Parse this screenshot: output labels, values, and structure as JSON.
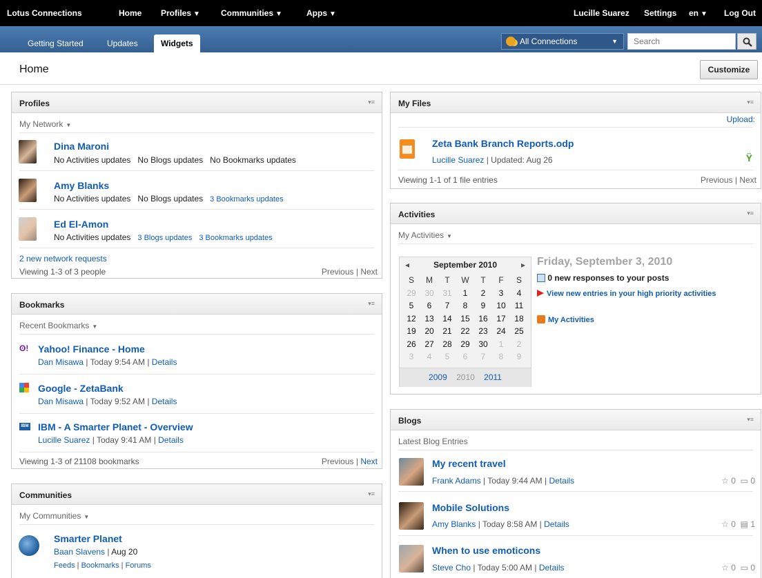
{
  "topbar": {
    "brand": "Lotus Connections",
    "nav": [
      "Home",
      "Profiles",
      "Communities",
      "Apps"
    ],
    "user": "Lucille Suarez",
    "settings": "Settings",
    "lang": "en",
    "logout": "Log Out"
  },
  "tabs": [
    "Getting Started",
    "Updates",
    "Widgets"
  ],
  "active_tab": "Widgets",
  "search": {
    "scope": "All Connections",
    "placeholder": "Search"
  },
  "page": {
    "title": "Home",
    "customize": "Customize"
  },
  "profiles": {
    "title": "Profiles",
    "filter": "My Network",
    "people": [
      {
        "name": "Dina Maroni",
        "updates": [
          "No Activities updates",
          "No Blogs updates",
          "No Bookmarks updates"
        ]
      },
      {
        "name": "Amy Blanks",
        "updates": [
          "No Activities updates",
          "No Blogs updates",
          "3 Bookmarks updates"
        ]
      },
      {
        "name": "Ed El-Amon",
        "updates": [
          "No Activities updates",
          "3 Blogs updates",
          "3 Bookmarks updates"
        ]
      }
    ],
    "requests": "2 new network requests",
    "viewing": "Viewing 1-3 of 3 people",
    "prev": "Previous",
    "next": "Next"
  },
  "bookmarks": {
    "title": "Bookmarks",
    "filter": "Recent Bookmarks",
    "items": [
      {
        "title": "Yahoo! Finance - Home",
        "author": "Dan Misawa",
        "time": "Today 9:54 AM",
        "details": "Details"
      },
      {
        "title": "Google - ZetaBank",
        "author": "Dan Misawa",
        "time": "Today 9:52 AM",
        "details": "Details"
      },
      {
        "title": "IBM - A Smarter Planet - Overview",
        "author": "Lucille Suarez",
        "time": "Today 9:41 AM",
        "details": "Details"
      }
    ],
    "viewing": "Viewing 1-3 of 21108 bookmarks",
    "prev": "Previous",
    "next": "Next"
  },
  "communities": {
    "title": "Communities",
    "filter": "My Communities",
    "items": [
      {
        "name": "Smarter Planet",
        "author": "Baan Slavens",
        "date": "Aug 20",
        "links": [
          "Feeds",
          "Bookmarks",
          "Forums"
        ]
      }
    ]
  },
  "files": {
    "title": "My Files",
    "upload": "Upload:",
    "items": [
      {
        "name": "Zeta Bank Branch Reports.odp",
        "author": "Lucille Suarez",
        "updated": "Updated: Aug 26"
      }
    ],
    "viewing": "Viewing 1-1 of 1 file entries",
    "prev": "Previous",
    "next": "Next"
  },
  "activities": {
    "title": "Activities",
    "filter": "My Activities",
    "calendar": {
      "month": "September 2010",
      "weekdays": [
        "S",
        "M",
        "T",
        "W",
        "T",
        "F",
        "S"
      ],
      "weeks": [
        [
          "29",
          "30",
          "31",
          "1",
          "2",
          "3",
          "4"
        ],
        [
          "5",
          "6",
          "7",
          "8",
          "9",
          "10",
          "11"
        ],
        [
          "12",
          "13",
          "14",
          "15",
          "16",
          "17",
          "18"
        ],
        [
          "19",
          "20",
          "21",
          "22",
          "23",
          "24",
          "25"
        ],
        [
          "26",
          "27",
          "28",
          "29",
          "30",
          "1",
          "2"
        ],
        [
          "3",
          "4",
          "5",
          "6",
          "7",
          "8",
          "9"
        ]
      ],
      "years": [
        "2009",
        "2010",
        "2011"
      ]
    },
    "date_heading": "Friday, September 3, 2010",
    "responses": "0 new responses to your posts",
    "high_priority": "View new entries in your high priority activities",
    "my_activities": "My Activities"
  },
  "blogs": {
    "title": "Blogs",
    "filter": "Latest Blog Entries",
    "items": [
      {
        "title": "My recent travel",
        "author": "Frank Adams",
        "time": "Today 9:44 AM",
        "details": "Details",
        "likes": "0",
        "comments": "0"
      },
      {
        "title": "Mobile Solutions",
        "author": "Amy Blanks",
        "time": "Today 8:58 AM",
        "details": "Details",
        "likes": "0",
        "comments": "1"
      },
      {
        "title": "When to use emoticons",
        "author": "Steve Cho",
        "time": "Today 5:00 AM",
        "details": "Details",
        "likes": "0",
        "comments": "0"
      }
    ]
  }
}
